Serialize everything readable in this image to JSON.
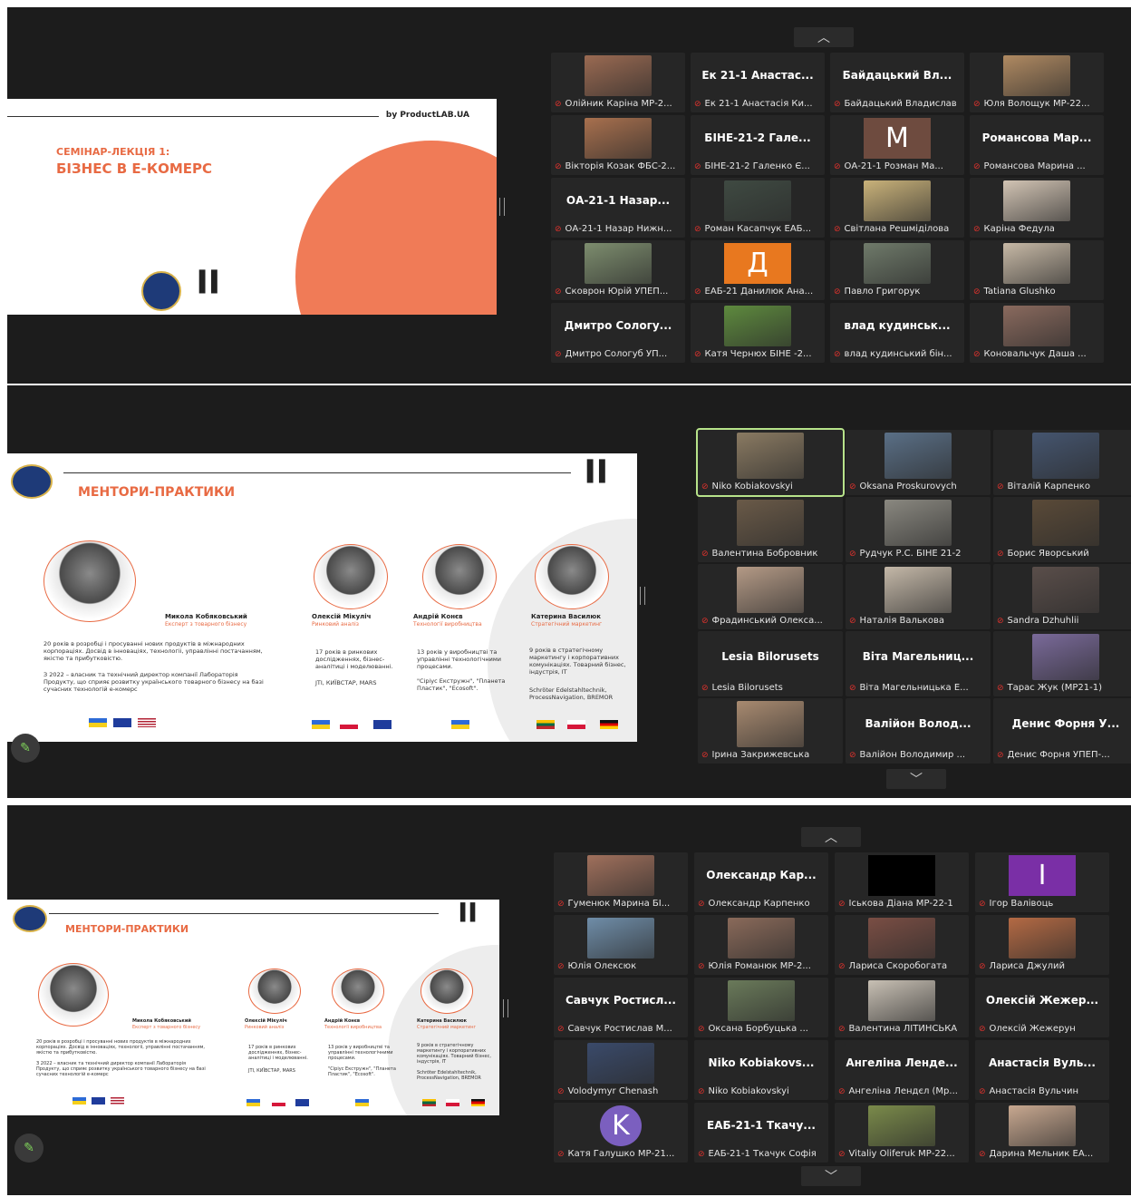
{
  "panel1": {
    "slide": {
      "brand": "by ProductLAB.UA",
      "subtitle": "СЕМІНАР-ЛЕКЦІЯ 1:",
      "title": "БІЗНЕС В Е-КОМЕРС"
    },
    "tiles": [
      {
        "type": "photo",
        "label": "Олійник Каріна МР-2...",
        "color": "#9a6a52"
      },
      {
        "type": "text",
        "big": "Ек 21-1 Анастас...",
        "label": "Ек 21-1 Анастасія Ки..."
      },
      {
        "type": "text",
        "big": "Байдацький Вл...",
        "label": "Байдацький Владислав"
      },
      {
        "type": "photo",
        "label": "Юля Волощук МР-22...",
        "color": "#b08a62"
      },
      {
        "type": "photo",
        "label": "Вікторія Козак ФБС-2...",
        "color": "#a8704e"
      },
      {
        "type": "text",
        "big": "БІНЕ-21-2 Гале...",
        "label": "БІНЕ-21-2 Галенко Є..."
      },
      {
        "type": "avatar",
        "letter": "M",
        "avatar_color": "#6e4b3f",
        "label": "ОА-21-1 Розман Ма..."
      },
      {
        "type": "text",
        "big": "Романсова Мар...",
        "label": "Романсова Марина ..."
      },
      {
        "type": "text",
        "big": "ОА-21-1 Назар...",
        "label": "ОА-21-1 Назар Нижн..."
      },
      {
        "type": "photo",
        "label": "Роман Касапчук ЕАБ...",
        "color": "#3f4a42"
      },
      {
        "type": "photo",
        "label": "Світлана Решміділова",
        "color": "#c9b27a"
      },
      {
        "type": "photo",
        "label": "Каріна Федула",
        "color": "#d2c4b4"
      },
      {
        "type": "photo",
        "label": "Сковрон Юрій УПЕП...",
        "color": "#7d8d6e"
      },
      {
        "type": "avatar",
        "letter": "Д",
        "avatar_color": "#e8781f",
        "label": "ЕАБ-21 Данилюк Ана..."
      },
      {
        "type": "photo",
        "label": "Павло Григорук",
        "color": "#6f7a6a"
      },
      {
        "type": "photo",
        "label": "Tatiana Glushko",
        "color": "#c7b9a6"
      },
      {
        "type": "text",
        "big": "Дмитро Сологу...",
        "label": "Дмитро Сологуб УП..."
      },
      {
        "type": "photo",
        "label": "Катя Чернюх БІНЕ -2...",
        "color": "#5e8a3e"
      },
      {
        "type": "text",
        "big": "влад кудинськ...",
        "label": "влад кудинський бін..."
      },
      {
        "type": "photo",
        "label": "Коновальчук Даша ...",
        "color": "#8a6a5e"
      }
    ]
  },
  "panel2": {
    "slide": {
      "title": "МЕНТОРИ-ПРАКТИКИ",
      "mentors": [
        {
          "name": "Микола Кобяковський",
          "role": "Експерт з товарного бізнесу",
          "text": "20 років в розробці і просуванні нових продуктів в міжнародних корпораціях. Досвід в інноваціях, технологіі, управлінні постачанням, якістю та прибутковістю.",
          "text2": "З 2022 – власник та технічний директор компанії Лабораторія Продукту, що сприяє розвитку українського товарного бізнесу на базі сучасних технологій е-комерс"
        },
        {
          "name": "Олексій Мікуліч",
          "role": "Ринковий аналіз",
          "text": "17 років в ринкових дослідженнях, бізнес-аналітиці і моделюванні.",
          "text2": "JTI, КИЇВСТАР, MARS"
        },
        {
          "name": "Андрій Конєв",
          "role": "Технології виробництва",
          "text": "13 років у виробництві та управлінні технологічними процесами.",
          "text2": "\"Сіріус Екстружн\", \"Планета Пластик\", \"Ecosoft\"."
        },
        {
          "name": "Катерина Василюк",
          "role": "Стратегічний маркетинг",
          "text": "9 років в стратегічному маркетингу і корпоративних комунікаціях. Товарний бізнес, індустрія, IT",
          "text2": "Schröter Edelstahltechnik, ProcessNavigation, BREMOR"
        }
      ]
    },
    "tiles": [
      {
        "type": "photo",
        "label": "Niko Kobiakovskyi",
        "color": "#8a7a62",
        "active": true
      },
      {
        "type": "photo",
        "label": "Oksana Proskurovych",
        "color": "#5a6f86"
      },
      {
        "type": "photo",
        "label": "Віталій Карпенко",
        "color": "#45556f"
      },
      {
        "type": "photo",
        "label": "Валентина Бобровник",
        "color": "#6a5a48"
      },
      {
        "type": "photo",
        "label": "Рудчук Р.С. БІНЕ 21-2",
        "color": "#8a8880"
      },
      {
        "type": "photo",
        "label": "Борис Яворський",
        "color": "#5a4a38"
      },
      {
        "type": "photo",
        "label": "Фрадинський Олекса...",
        "color": "#b49a86"
      },
      {
        "type": "photo",
        "label": "Наталія Валькова",
        "color": "#c4b8a8"
      },
      {
        "type": "photo",
        "label": "Sandra Dzhuhlii",
        "color": "#5a4e4a"
      },
      {
        "type": "text",
        "big": "Lesia Bilorusets",
        "label": "Lesia Bilorusets"
      },
      {
        "type": "text",
        "big": "Віта Магельниц...",
        "label": "Віта Магельницька Е..."
      },
      {
        "type": "photo",
        "label": "Тарас Жук (МР21-1)",
        "color": "#7a6a9a"
      },
      {
        "type": "photo",
        "label": "Ірина Закрижевська",
        "color": "#a88a70"
      },
      {
        "type": "text",
        "big": "Валійон Волод...",
        "label": "Валійон Володимир ..."
      },
      {
        "type": "text",
        "big": "Денис Форня У...",
        "label": "Денис Форня УПЕП-..."
      }
    ]
  },
  "panel3": {
    "tiles": [
      {
        "type": "photo",
        "label": "Гуменюк Марина БІ...",
        "color": "#a0705c"
      },
      {
        "type": "text",
        "big": "Олександр Кар...",
        "label": "Олександр Карпенко"
      },
      {
        "type": "avatar",
        "letter": "",
        "avatar_color": "#000000",
        "label": "Іськова Діана МР-22-1"
      },
      {
        "type": "avatar",
        "letter": "I",
        "avatar_color": "#7a2fa6",
        "label": "Ігор Валівоць"
      },
      {
        "type": "photo",
        "label": "Юлія Олексюк",
        "color": "#6f8da8"
      },
      {
        "type": "photo",
        "label": "Юлія Романюк МР-2...",
        "color": "#8a6a5a"
      },
      {
        "type": "photo",
        "label": "Лариса Скоробогата",
        "color": "#7a4e44"
      },
      {
        "type": "photo",
        "label": "Лариса Джулий",
        "color": "#b46a44"
      },
      {
        "type": "text",
        "big": "Савчук Ростисл...",
        "label": "Савчук Ростислав М..."
      },
      {
        "type": "photo",
        "label": "Оксана Борбуцька ...",
        "color": "#6a7a5a"
      },
      {
        "type": "photo",
        "label": "Валентина ЛІТИНСЬКА",
        "color": "#c8c0b4"
      },
      {
        "type": "text",
        "big": "Олексій Жежер...",
        "label": "Олексій Жежерун"
      },
      {
        "type": "photo",
        "label": "Volodymyr Chenash",
        "color": "#3a4a6a"
      },
      {
        "type": "text",
        "big": "Niko Kobiakovs...",
        "label": "Niko Kobiakovskyi"
      },
      {
        "type": "text",
        "big": "Ангеліна Ленде...",
        "label": "Ангеліна Лендєл (Мр..."
      },
      {
        "type": "text",
        "big": "Анастасія Вуль...",
        "label": "Анастасія Вульчин"
      },
      {
        "type": "avatar",
        "letter": "K",
        "avatar_color": "#7b5fbf",
        "round": true,
        "label": "Катя Галушко МР-21..."
      },
      {
        "type": "text",
        "big": "ЕАБ-21-1 Ткачу...",
        "label": "ЕАБ-21-1 Ткачук Софія"
      },
      {
        "type": "photo",
        "label": "Vitaliy Oliferuk МР-22...",
        "color": "#7a8a4a"
      },
      {
        "type": "photo",
        "label": "Дарина Мельник ЕА...",
        "color": "#c8a890"
      }
    ]
  },
  "colors": {
    "accent": "#e86a43",
    "mic_muted": "#e0322d",
    "active_speaker": "#b7e38a",
    "panel_bg": "#1c1c1c",
    "tile_bg": "#262626"
  }
}
